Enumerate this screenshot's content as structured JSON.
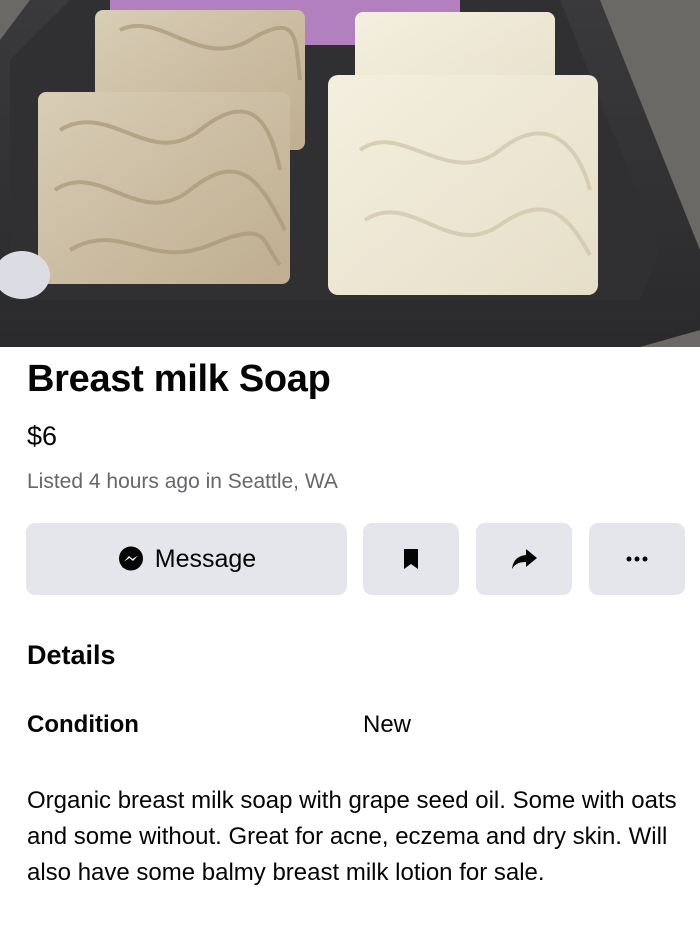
{
  "listing": {
    "title": "Breast milk Soap",
    "price": "$6",
    "listed": "Listed 4 hours ago in Seattle, WA"
  },
  "actions": {
    "message_label": "Message",
    "message_icon": "messenger-icon",
    "save_icon": "bookmark-icon",
    "share_icon": "share-arrow-icon",
    "more_icon": "more-dots-icon"
  },
  "details": {
    "heading": "Details",
    "condition_label": "Condition",
    "condition_value": "New",
    "description": "Organic breast milk soap with grape seed oil. Some with oats and some without. Great for acne, eczema and dry skin. Will also have some balmy breast milk lotion for sale."
  },
  "colors": {
    "button_bg": "#e4e6eb",
    "secondary_text": "#65676b",
    "primary_text": "#050505"
  }
}
